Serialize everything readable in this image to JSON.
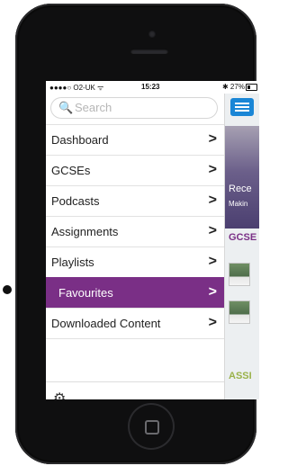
{
  "status": {
    "carrier": "●●●●○ O2-UK ᯤ",
    "time": "15:23",
    "battery": "✱ 27%"
  },
  "menu": {
    "search_placeholder": "Search",
    "items": [
      {
        "label": "Dashboard"
      },
      {
        "label": "GCSEs"
      },
      {
        "label": "Podcasts"
      },
      {
        "label": "Assignments"
      },
      {
        "label": "Playlists"
      },
      {
        "label": "Favourites",
        "active": true
      },
      {
        "label": "Downloaded Content"
      }
    ],
    "chevron": ">"
  },
  "background": {
    "hero_title": "Rece",
    "hero_subtitle": "Makin",
    "section1": "GCSE",
    "section2": "ASSI"
  },
  "icons": {
    "search": "search-icon",
    "settings": "gear-icon",
    "menu": "hamburger-icon"
  },
  "colors": {
    "accent": "#7a2f86",
    "menu_button": "#1a86d6"
  }
}
